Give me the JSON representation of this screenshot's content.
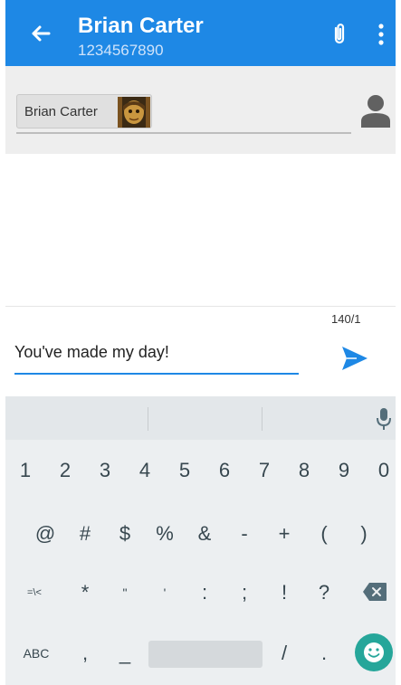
{
  "header": {
    "title": "Brian Carter",
    "subtitle": "1234567890",
    "back_icon": "arrow-left-icon",
    "attach_icon": "paperclip-icon",
    "more_icon": "more-vertical-icon",
    "color": "#1E88E5"
  },
  "recipient": {
    "chip_label": "Brian Carter",
    "contact_icon": "person-icon"
  },
  "compose": {
    "counter": "140/1",
    "message": "You've made my day!",
    "send_icon": "send-icon"
  },
  "keyboard": {
    "row1": [
      "1",
      "2",
      "3",
      "4",
      "5",
      "6",
      "7",
      "8",
      "9",
      "0"
    ],
    "row2": [
      "@",
      "#",
      "$",
      "%",
      "&",
      "-",
      "+",
      "(",
      ")"
    ],
    "row3": [
      "=\\<",
      "*",
      "\"",
      "'",
      ":",
      ";",
      "!",
      "?"
    ],
    "row4": {
      "abc": "ABC",
      "comma": ",",
      "underscore": "_",
      "slash": "/",
      "period": "."
    },
    "mic_icon": "microphone-icon",
    "backspace_icon": "backspace-icon",
    "emoji_icon": "smiley-icon"
  }
}
